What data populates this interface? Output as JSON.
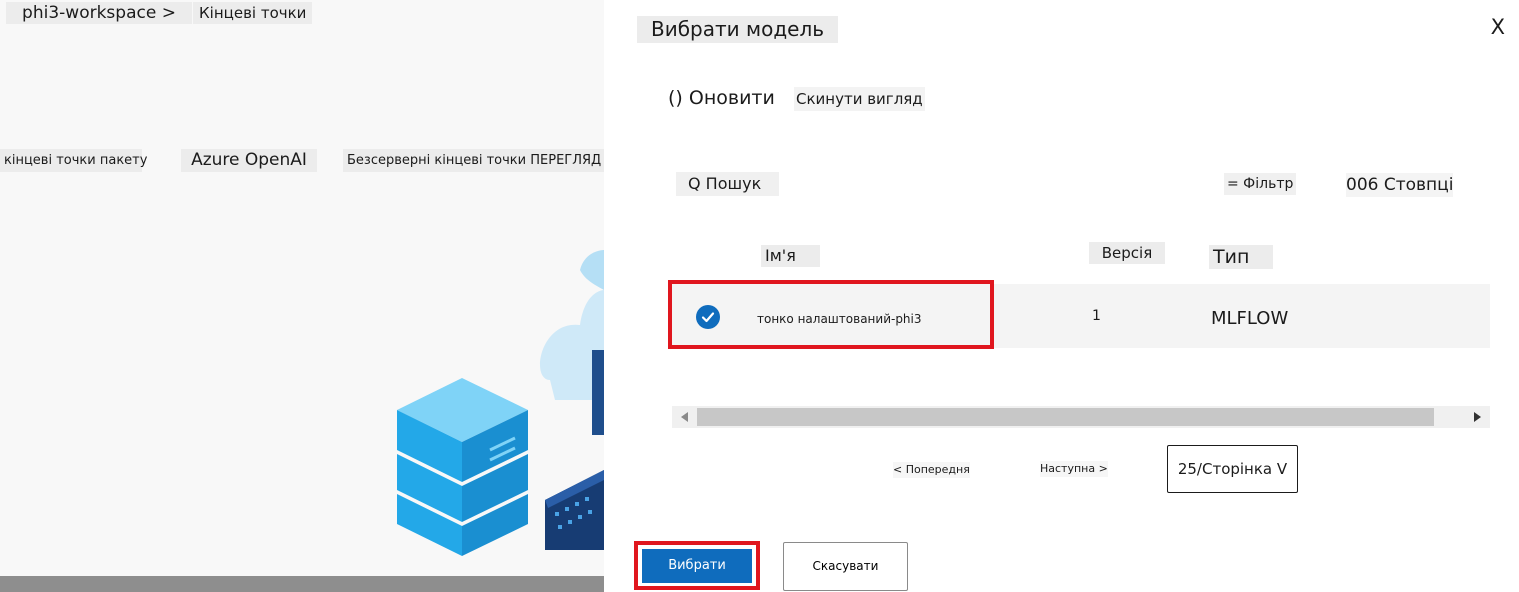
{
  "background_page": {
    "breadcrumb": {
      "workspace": "phi3-workspace >",
      "current": "Кінцеві точки"
    },
    "tabs": [
      "кінцеві точки пакету",
      "Azure OpenAI",
      "Безсерверні кінцеві точки ПЕРЕГЛЯД"
    ]
  },
  "panel": {
    "title": "Вибрати модель",
    "close_label": "X",
    "toolbar": {
      "refresh": "() Оновити",
      "reset_view": "Скинути вигляд"
    },
    "search_placeholder": "Q Пошук",
    "filter": "= Фільтр",
    "columns": "006 Стовпці",
    "table": {
      "headers": {
        "name": "Ім'я",
        "version": "Версія",
        "type": "Тип"
      },
      "rows": [
        {
          "selected": true,
          "name": "тонко налаштований-phi3",
          "version": "1",
          "type": "MLFLOW"
        }
      ]
    },
    "pagination": {
      "prev": "< Попередня",
      "next": "Наступна >",
      "page_size": "25/Сторінка V"
    },
    "buttons": {
      "select": "Вибрати",
      "cancel": "Скасувати"
    }
  },
  "colors": {
    "accent": "#0f6cbd",
    "highlight": "#e0161e"
  }
}
